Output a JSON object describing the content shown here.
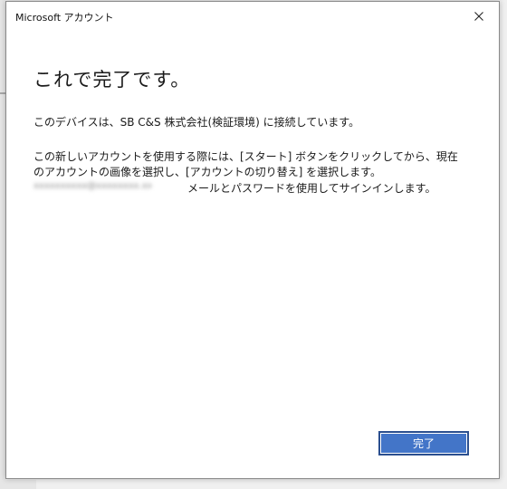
{
  "window": {
    "title": "Microsoft アカウント",
    "close_icon": "close-icon"
  },
  "content": {
    "heading": "これで完了です。",
    "status_line": "このデバイスは、SB C&S 株式会社(検証環境) に接続しています。",
    "instruction_line1": "この新しいアカウントを使用する際には、[スタート] ボタンをクリックしてから、現在",
    "instruction_line2": "のアカウントの画像を選択し、[アカウントの切り替え] を選択します。",
    "email_redacted": "xxxxxxxxxx@xxxxxxxx.xx.xxxxx",
    "signin_text": "メールとパスワードを使用してサインインします。"
  },
  "buttons": {
    "done_label": "完了"
  },
  "colors": {
    "accent": "#4375c8",
    "accent_border": "#2b4f8f",
    "background": "#ffffff",
    "text": "#1a1a1a"
  }
}
